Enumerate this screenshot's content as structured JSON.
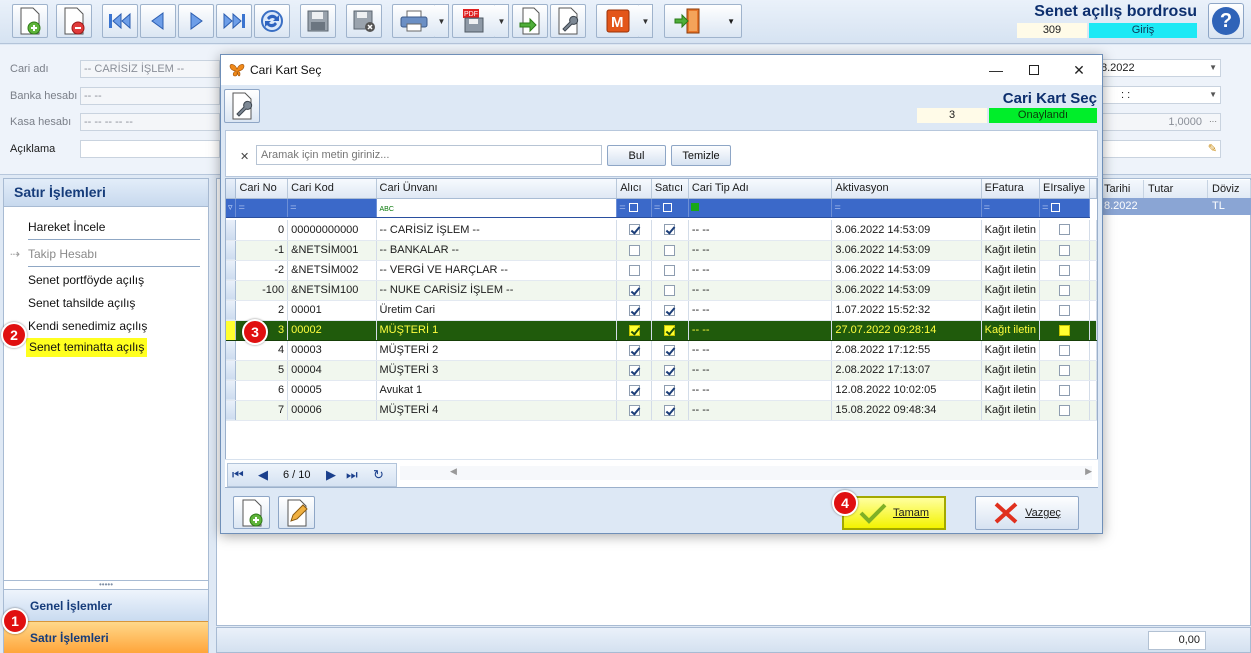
{
  "header": {
    "title": "Senet açılış bordrosu",
    "number": "309",
    "status": "Giriş"
  },
  "form": {
    "cari_adi_label": "Cari adı",
    "cari_adi_value": "-- CARİSİZ İŞLEM --",
    "banka_label": "Banka hesabı",
    "banka_value": "-- --",
    "kasa_label": "Kasa hesabı",
    "kasa_value": "-- -- -- -- --",
    "aciklama_label": "Açıklama",
    "date_value": "8.2022",
    "time_value": ": :",
    "rate_value": "1,0000"
  },
  "left_panel": {
    "title": "Satır İşlemleri",
    "items": [
      {
        "label": "Hareket İncele"
      },
      {
        "label": "Takip Hesabı"
      },
      {
        "label": "Senet portföyde açılış"
      },
      {
        "label": "Senet tahsilde açılış"
      },
      {
        "label": "Kendi senedimiz açılış"
      },
      {
        "label": "Senet teminatta açılış"
      }
    ],
    "tab_general": "Genel İşlemler",
    "tab_rows": "Satır İşlemleri"
  },
  "background_grid": {
    "columns": [
      "Tarihi",
      "Tutar",
      "Döviz"
    ],
    "row": [
      "8.2022",
      "",
      "TL"
    ],
    "total": "0,00"
  },
  "dialog": {
    "window_title": "Cari Kart Seç",
    "header_title": "Cari Kart Seç",
    "number": "3",
    "status": "Onaylandı",
    "search": {
      "placeholder": "Aramak için metin giriniz...",
      "find_label": "Bul",
      "clear_label": "Temizle"
    },
    "columns": [
      "Cari No",
      "Cari Kod",
      "Cari Ünvanı",
      "Alıcı",
      "Satıcı",
      "Cari Tip Adı",
      "Aktivasyon",
      "EFatura",
      "EIrsaliye"
    ],
    "rows": [
      {
        "no": "0",
        "kod": "00000000000",
        "unvan": "-- CARİSİZ İŞLEM --",
        "alici": true,
        "satici": true,
        "tip": "-- --",
        "aktivasyon": "3.06.2022 14:53:09",
        "efatura": "Kağıt iletin"
      },
      {
        "no": "-1",
        "kod": "&NETSİM001",
        "unvan": "-- BANKALAR --",
        "alici": false,
        "satici": false,
        "tip": "-- --",
        "aktivasyon": "3.06.2022 14:53:09",
        "efatura": "Kağıt iletin"
      },
      {
        "no": "-2",
        "kod": "&NETSİM002",
        "unvan": "-- VERGİ VE HARÇLAR --",
        "alici": false,
        "satici": false,
        "tip": "-- --",
        "aktivasyon": "3.06.2022 14:53:09",
        "efatura": "Kağıt iletin"
      },
      {
        "no": "-100",
        "kod": "&NETSİM100",
        "unvan": "-- NUKE CARİSİZ İŞLEM --",
        "alici": true,
        "satici": false,
        "tip": "-- --",
        "aktivasyon": "3.06.2022 14:53:09",
        "efatura": "Kağıt iletin"
      },
      {
        "no": "2",
        "kod": "00001",
        "unvan": "Üretim Cari",
        "alici": true,
        "satici": true,
        "tip": "-- --",
        "aktivasyon": "1.07.2022 15:52:32",
        "efatura": "Kağıt iletin"
      },
      {
        "no": "3",
        "kod": "00002",
        "unvan": "MÜŞTERİ 1",
        "alici": true,
        "satici": true,
        "tip": "-- --",
        "aktivasyon": "27.07.2022 09:28:14",
        "efatura": "Kağıt iletin"
      },
      {
        "no": "4",
        "kod": "00003",
        "unvan": "MÜŞTERİ 2",
        "alici": true,
        "satici": true,
        "tip": "-- --",
        "aktivasyon": "2.08.2022 17:12:55",
        "efatura": "Kağıt iletin"
      },
      {
        "no": "5",
        "kod": "00004",
        "unvan": "MÜŞTERİ 3",
        "alici": true,
        "satici": true,
        "tip": "-- --",
        "aktivasyon": "2.08.2022 17:13:07",
        "efatura": "Kağıt iletin"
      },
      {
        "no": "6",
        "kod": "00005",
        "unvan": "Avukat 1",
        "alici": true,
        "satici": true,
        "tip": "-- --",
        "aktivasyon": "12.08.2022 10:02:05",
        "efatura": "Kağıt iletin"
      },
      {
        "no": "7",
        "kod": "00006",
        "unvan": "MÜŞTERİ 4",
        "alici": true,
        "satici": true,
        "tip": "-- --",
        "aktivasyon": "15.08.2022 09:48:34",
        "efatura": "Kağıt iletin"
      }
    ],
    "selected_row": 5,
    "filter_abc": "ABC",
    "nav_position": "6 / 10",
    "ok_label": "Tamam",
    "cancel_label": "Vazgeç"
  },
  "markers": [
    "1",
    "2",
    "3",
    "4"
  ],
  "colors": {
    "selected_row_bg": "#205b0c",
    "selected_row_text": "#ffff40",
    "status_green": "#00ee2a",
    "status_cyan": "#1de9f5",
    "highlight_yellow": "#ffff1f",
    "marker_red": "#e01010"
  },
  "icons": {
    "toolbar": [
      "new-document-icon",
      "delete-document-icon",
      "first-record-icon",
      "previous-record-icon",
      "next-record-icon",
      "last-record-icon",
      "refresh-icon",
      "save-icon",
      "save-close-icon",
      "print-icon",
      "pdf-export-icon",
      "import-icon",
      "tools-icon",
      "m-icon",
      "exit-door-icon"
    ]
  }
}
